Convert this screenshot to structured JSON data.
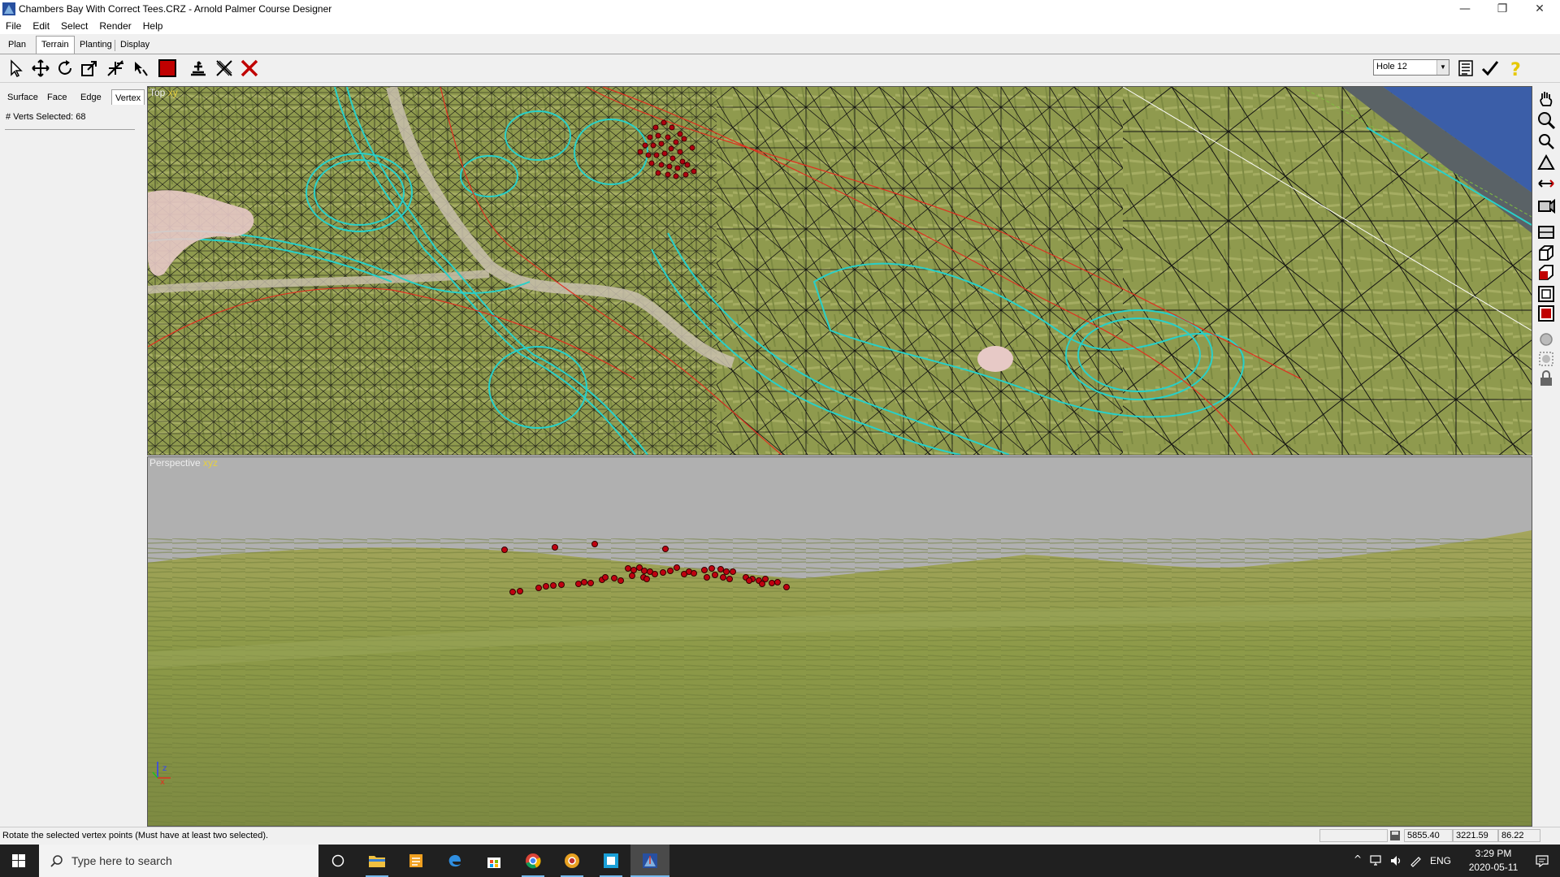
{
  "window": {
    "title": "Chambers Bay With Correct Tees.CRZ - Arnold Palmer Course Designer",
    "minimize_glyph": "—",
    "restore_glyph": "❐",
    "close_glyph": "✕"
  },
  "menu": {
    "items": [
      "File",
      "Edit",
      "Select",
      "Render",
      "Help"
    ]
  },
  "mode_tabs": [
    "Plan",
    "Terrain",
    "Planting",
    "Display"
  ],
  "toolbar": {
    "tools": [
      "select-arrow-icon",
      "move-icon",
      "rotate-icon",
      "scale-icon",
      "split-icon",
      "pick-icon",
      "fill-red-icon",
      "stamp-icon",
      "cross-thin-icon",
      "delete-red-icon"
    ],
    "hole_select": "Hole 12",
    "accent": "#cc0000"
  },
  "left_panel": {
    "tabs": [
      "Surface",
      "Face",
      "Edge",
      "Vertex"
    ],
    "verts_selected": "# Verts Selected: 68"
  },
  "viewports": {
    "top": {
      "name": "Top",
      "axes": "xy"
    },
    "perspective": {
      "name": "Perspective",
      "axes": "xyz"
    }
  },
  "right_tools": [
    "hand-icon",
    "zoom-icon",
    "zoom-box-icon",
    "orbit-icon",
    "pan-axis-icon",
    "camera-icon",
    "view-3d-icon",
    "view-frame-icon",
    "view-red-icon",
    "viewport-icon",
    "viewport-red-icon",
    "light-icon",
    "light-dim-icon",
    "lock-icon"
  ],
  "status": {
    "message": "Rotate the selected vertex points (Must have at least two selected).",
    "x": "5855.40",
    "y": "3221.59",
    "z": "86.22"
  },
  "taskbar": {
    "search_placeholder": "Type here to search",
    "time": "3:29 PM",
    "date": "2020-05-11",
    "lang": "ENG"
  },
  "colors": {
    "grass": "#8a9a48",
    "contour": "#28d0c8",
    "boundary": "#e03020",
    "vertex": "#c00010",
    "sky": "#b0b0b0"
  }
}
